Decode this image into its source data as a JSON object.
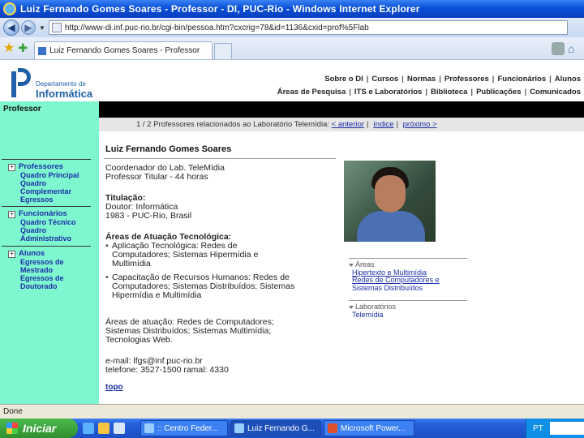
{
  "window": {
    "title": "Luiz Fernando Gomes Soares - Professor - DI, PUC-Rio - Windows Internet Explorer",
    "url": "http://www-di.inf.puc-rio.br/cgi-bin/pessoa.htm?cxcrig=78&id=1136&cxid=prof%5Flab",
    "tab_title": "Luiz Fernando Gomes Soares - Professor"
  },
  "logo": {
    "line1": "Departamento de",
    "line2": "Informática"
  },
  "topnav": {
    "row1": [
      "Sobre o DI",
      "Cursos",
      "Normas",
      "Professores",
      "Funcionários",
      "Alunos"
    ],
    "row2": [
      "Áreas de Pesquisa",
      "ITS e Laboratórios",
      "Biblioteca",
      "Publicações",
      "Comunicados"
    ]
  },
  "sidebar": {
    "title": "Professor",
    "groups": [
      {
        "header": "Professores",
        "items": [
          "Quadro Principal",
          "Quadro",
          "Complementar",
          "Egressos"
        ]
      },
      {
        "header": "Funcionários",
        "items": [
          "Quadro Técnico",
          "Quadro",
          "Administrativo"
        ]
      },
      {
        "header": "Alunos",
        "items": [
          "Egressos de",
          "Mestrado",
          "Egressos de",
          "Doutorado"
        ]
      }
    ]
  },
  "breadcrumb": {
    "text": "1 / 2 Professores relacionados ao Laboratório Telemídia:",
    "anterior": "< anterior",
    "indice": "índice",
    "proximo": "próximo >"
  },
  "profile": {
    "name": "Luiz Fernando Gomes Soares",
    "role1": "Coordenador do Lab. TeleMídia",
    "role2": "Professor Titular - 44 horas",
    "titulacao_label": "Titulação:",
    "titulacao_1": "Doutor: Informática",
    "titulacao_2": "1983 - PUC-Rio, Brasil",
    "areas_tec_label": "Áreas de Atuação Tecnológica:",
    "areas_tec": [
      [
        "Aplicação Tecnológica: Redes de",
        "Computadores; Sistemas Hipermídia e",
        "Multimídia"
      ],
      [
        "Capacitação de Recursos Humanos: Redes de",
        "Computadores; Sistemas Distribuídos; Sistemas",
        "Hipermídia e Multimídia"
      ]
    ],
    "areas_atuacao": [
      "Áreas de atuação: Redes de Computadores;",
      "Sistemas Distribuídos; Sistemas Multimídia;",
      "Tecnologias Web."
    ],
    "email": "e-mail: lfgs@inf.puc-rio.br",
    "telefone": "telefone: 3527-1500 ramal: 4330",
    "topo": "topo"
  },
  "side_panel": {
    "areas_label": "Áreas",
    "areas": [
      "Hipertexto e Multimídia",
      "Redes de Computadores e",
      "Sistemas Distribuídos"
    ],
    "labs_label": "Laboratórios",
    "labs": [
      "Telemídia"
    ]
  },
  "status": {
    "text": "Done"
  },
  "taskbar": {
    "start": "Iniciar",
    "buttons": [
      ":: Centro Feder...",
      "Luiz Fernando G...",
      "Microsoft Power..."
    ],
    "tray": "PT"
  }
}
